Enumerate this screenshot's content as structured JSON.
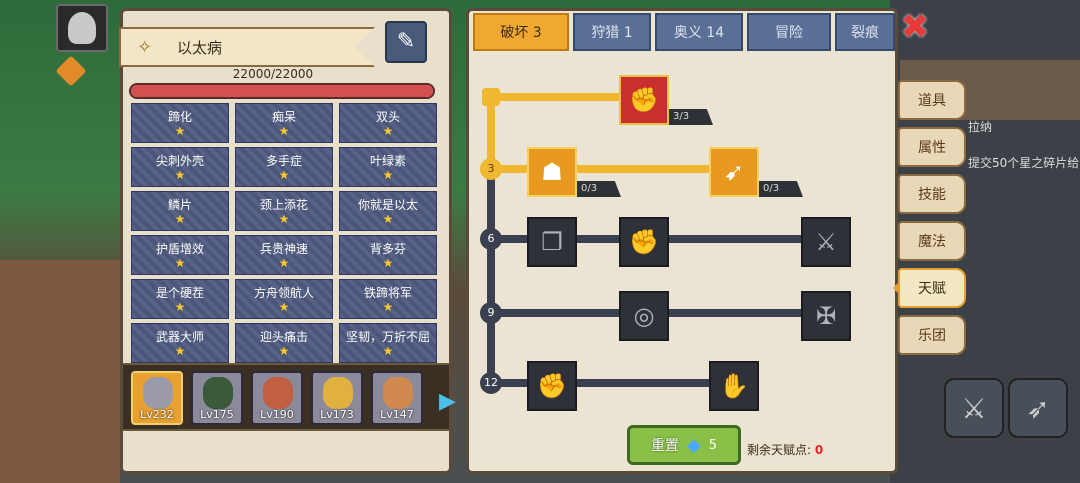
{
  "hero": {
    "name": "以太病",
    "hp": "22000/22000",
    "hp_fill": 1.0,
    "icon": "wings-icon",
    "edit_icon": "quill-icon"
  },
  "traits": [
    {
      "name": "蹄化"
    },
    {
      "name": "痴呆"
    },
    {
      "name": "双头"
    },
    {
      "name": "尖刺外壳"
    },
    {
      "name": "多手症"
    },
    {
      "name": "叶绿素"
    },
    {
      "name": "鳞片"
    },
    {
      "name": "颈上添花"
    },
    {
      "name": "你就是以太"
    },
    {
      "name": "护盾增效"
    },
    {
      "name": "兵贵神速"
    },
    {
      "name": "背多芬"
    },
    {
      "name": "是个硬茬"
    },
    {
      "name": "方舟领航人"
    },
    {
      "name": "铁蹄将军"
    },
    {
      "name": "武器大师"
    },
    {
      "name": "迎头痛击"
    },
    {
      "name": "坚韧，万折不屈"
    }
  ],
  "star": "★",
  "team": [
    {
      "level": "Lv232",
      "active": true,
      "color": "#9a9aa8"
    },
    {
      "level": "Lv175",
      "active": false,
      "color": "#3a5a3a"
    },
    {
      "level": "Lv190",
      "active": false,
      "color": "#c06040"
    },
    {
      "level": "Lv173",
      "active": false,
      "color": "#e0b040"
    },
    {
      "level": "Lv147",
      "active": false,
      "color": "#d08a50"
    }
  ],
  "tabs": [
    {
      "label": "破坏 3",
      "active": true
    },
    {
      "label": "狩猎 1",
      "active": false
    },
    {
      "label": "奥义 14",
      "active": false
    },
    {
      "label": "冒险",
      "active": false
    },
    {
      "label": "裂痕",
      "active": false
    }
  ],
  "talent_tree": {
    "tiers": [
      {
        "label": ""
      },
      {
        "label": "3"
      },
      {
        "label": "6"
      },
      {
        "label": "9"
      },
      {
        "label": "12"
      }
    ],
    "nodes": [
      {
        "icon": "arm-wrestle-icon",
        "count": "3/3"
      },
      {
        "icon": "muscle-body-icon",
        "count": "0/3"
      },
      {
        "icon": "arrow-burst-icon",
        "count": "0/3"
      },
      {
        "icon": "card-swap-icon"
      },
      {
        "icon": "fist-clash-icon"
      },
      {
        "icon": "sword-slash-icon"
      },
      {
        "icon": "vortex-icon"
      },
      {
        "icon": "bat-wing-icon"
      },
      {
        "icon": "raised-fist-icon"
      },
      {
        "icon": "gauntlet-icon"
      }
    ]
  },
  "reset": {
    "label": "重置",
    "cost": "5",
    "gem_icon": "diamond-icon"
  },
  "points": {
    "label": "剩余天赋点:",
    "value": "0"
  },
  "side_menu": [
    {
      "label": "道具",
      "active": false
    },
    {
      "label": "属性",
      "active": false
    },
    {
      "label": "技能",
      "active": false
    },
    {
      "label": "魔法",
      "active": false
    },
    {
      "label": "天赋",
      "active": true
    },
    {
      "label": "乐团",
      "active": false
    }
  ],
  "world": {
    "npc_name": "拉纳",
    "quest_text": "提交50个星之碎片给"
  }
}
